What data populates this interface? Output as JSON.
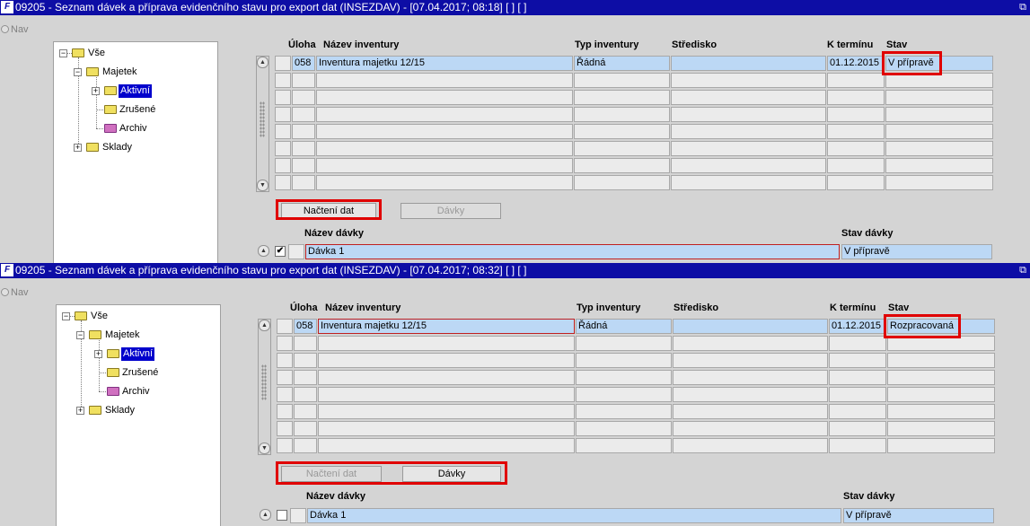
{
  "windows": [
    {
      "title": "09205 - Seznam dávek a příprava evidenčního stavu pro export dat (INSEZDAV) - [07.04.2017; 08:18]  [ ]  [ ]",
      "app_icon": "F",
      "restore_glyph": "⧉",
      "nav_label": "Nav",
      "tree": [
        {
          "label": "Vše",
          "expander": "−"
        },
        {
          "label": "Majetek",
          "expander": "−"
        },
        {
          "label": "Aktivní",
          "expander": "+"
        },
        {
          "label": "Zrušené"
        },
        {
          "label": "Archiv"
        },
        {
          "label": "Sklady",
          "expander": "+"
        }
      ],
      "columns": {
        "uloha": "Úloha",
        "nazev": "Název inventury",
        "typ": "Typ inventury",
        "stredisko": "Středisko",
        "termin": "K termínu",
        "stav": "Stav"
      },
      "row": {
        "uloha": "058",
        "nazev": "Inventura majetku 12/15",
        "typ": "Řádná",
        "stredisko": "",
        "termin": "01.12.2015",
        "stav": "V přípravě"
      },
      "buttons": {
        "nacteni": "Načtení dat",
        "davky": "Dávky"
      },
      "batch": {
        "header_name": "Název dávky",
        "header_state": "Stav dávky",
        "name": "Dávka 1",
        "state": "V přípravě",
        "checked": "✔"
      }
    },
    {
      "title": "09205 - Seznam dávek a příprava evidenčního stavu pro export dat (INSEZDAV) - [07.04.2017; 08:32]  [ ]  [ ]",
      "app_icon": "F",
      "restore_glyph": "⧉",
      "nav_label": "Nav",
      "tree": [
        {
          "label": "Vše",
          "expander": "−"
        },
        {
          "label": "Majetek",
          "expander": "−"
        },
        {
          "label": "Aktivní",
          "expander": "+"
        },
        {
          "label": "Zrušené"
        },
        {
          "label": "Archiv"
        },
        {
          "label": "Sklady",
          "expander": "+"
        }
      ],
      "columns": {
        "uloha": "Úloha",
        "nazev": "Název inventury",
        "typ": "Typ inventury",
        "stredisko": "Středisko",
        "termin": "K termínu",
        "stav": "Stav"
      },
      "row": {
        "uloha": "058",
        "nazev": "Inventura majetku 12/15",
        "typ": "Řádná",
        "stredisko": "",
        "termin": "01.12.2015",
        "stav": "Rozpracovaná"
      },
      "buttons": {
        "nacteni": "Načtení dat",
        "davky": "Dávky"
      },
      "batch": {
        "header_name": "Název dávky",
        "header_state": "Stav dávky",
        "name": "Dávka 1",
        "state": "V přípravě",
        "checked": ""
      }
    }
  ],
  "colors": {
    "titlebar": "#0d0da5",
    "selection": "#0000cc",
    "current_row": "#bcd8f5",
    "highlight": "#e00000"
  }
}
